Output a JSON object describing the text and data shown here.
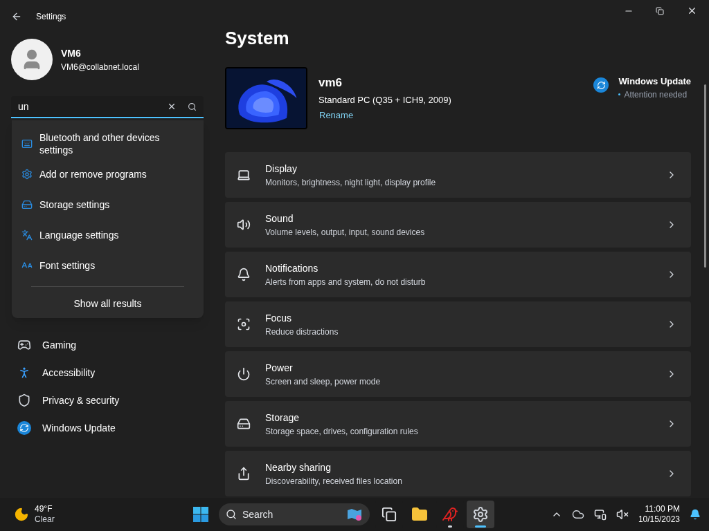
{
  "window": {
    "title": "Settings"
  },
  "user": {
    "name": "VM6",
    "email": "VM6@collabnet.local"
  },
  "search": {
    "value": "un"
  },
  "search_results": [
    {
      "label": "Bluetooth and other devices settings"
    },
    {
      "label": "Add or remove programs"
    },
    {
      "label": "Storage settings"
    },
    {
      "label": "Language settings"
    },
    {
      "label": "Font settings"
    }
  ],
  "search_show_all": "Show all results",
  "nav_items": [
    {
      "label": "Gaming"
    },
    {
      "label": "Accessibility"
    },
    {
      "label": "Privacy & security"
    },
    {
      "label": "Windows Update"
    }
  ],
  "page_title": "System",
  "device": {
    "name": "vm6",
    "model": "Standard PC (Q35 + ICH9, 2009)",
    "rename_link": "Rename"
  },
  "update_status": {
    "title": "Windows Update",
    "status": "Attention needed"
  },
  "settings_cards": [
    {
      "title": "Display",
      "subtitle": "Monitors, brightness, night light, display profile"
    },
    {
      "title": "Sound",
      "subtitle": "Volume levels, output, input, sound devices"
    },
    {
      "title": "Notifications",
      "subtitle": "Alerts from apps and system, do not disturb"
    },
    {
      "title": "Focus",
      "subtitle": "Reduce distractions"
    },
    {
      "title": "Power",
      "subtitle": "Screen and sleep, power mode"
    },
    {
      "title": "Storage",
      "subtitle": "Storage space, drives, configuration rules"
    },
    {
      "title": "Nearby sharing",
      "subtitle": "Discoverability, received files location"
    }
  ],
  "taskbar": {
    "weather": {
      "temperature": "49°F",
      "condition": "Clear"
    },
    "search_placeholder": "Search",
    "apps": [
      {
        "active": false,
        "running": false
      },
      {
        "active": false,
        "running": false
      },
      {
        "active": false,
        "running": true
      },
      {
        "active": true,
        "running": true
      }
    ],
    "clock": {
      "time": "11:00 PM",
      "date": "10/15/2023"
    }
  }
}
